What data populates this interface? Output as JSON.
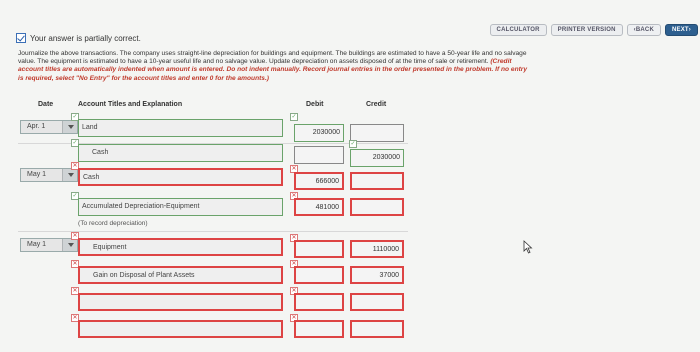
{
  "toolbar": {
    "calculator": "CALCULATOR",
    "printer": "PRINTER VERSION",
    "back": "‹BACK",
    "next": "NEXT›"
  },
  "status": {
    "text": "Your answer is partially correct."
  },
  "instructions": {
    "line1": "Journalize the above transactions. The company uses straight-line depreciation for buildings and equipment. The buildings are estimated to have a 50-year life and no salvage",
    "line2": "value. The equipment is estimated to have a 10-year useful life and no salvage value. Update depreciation on assets disposed of at the time of sale or retirement.",
    "line2_red": "(Credit",
    "line3_red": "account titles are automatically indented when amount is entered. Do not indent manually. Record journal entries in the order presented in the problem. If no entry",
    "line4_red": "is required, select \"No Entry\" for the account titles and enter 0 for the amounts.)"
  },
  "table": {
    "headers": {
      "date": "Date",
      "account": "Account Titles and Explanation",
      "debit": "Debit",
      "credit": "Credit"
    },
    "rows": [
      {
        "date": "Apr. 1",
        "account": "Land",
        "debit": "2030000",
        "credit": ""
      },
      {
        "date": "",
        "account": "Cash",
        "debit": "",
        "credit": "2030000"
      },
      {
        "date": "May 1",
        "account": "Cash",
        "debit": "666000",
        "credit": ""
      },
      {
        "date": "",
        "account": "Accumulated Depreciation-Equipment",
        "debit": "481000",
        "credit": ""
      },
      {
        "date": "May 1",
        "account": "Equipment",
        "debit": "",
        "credit": "1110000"
      },
      {
        "date": "",
        "account": "Gain on Disposal of Plant Assets",
        "debit": "",
        "credit": "37000"
      },
      {
        "date": "",
        "account": "",
        "debit": "",
        "credit": ""
      },
      {
        "date": "",
        "account": "",
        "debit": "",
        "credit": ""
      }
    ],
    "note": "(To record depreciation)"
  }
}
